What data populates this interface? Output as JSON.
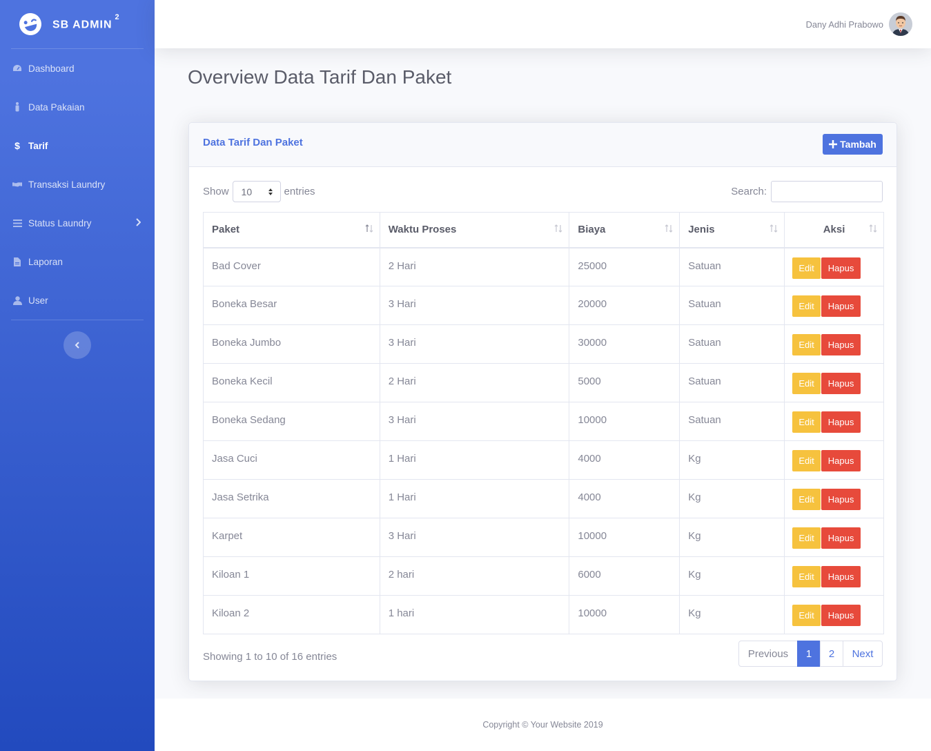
{
  "sidebar": {
    "brand": "SB ADMIN",
    "brand_sup": "2",
    "items": [
      {
        "label": "Dashboard",
        "icon": "tachometer-icon"
      },
      {
        "label": "Data Pakaian",
        "icon": "user-male-icon"
      },
      {
        "label": "Tarif",
        "icon": "dollar-icon",
        "active": true
      },
      {
        "label": "Transaksi Laundry",
        "icon": "handshake-icon"
      },
      {
        "label": "Status Laundry",
        "icon": "bars-icon",
        "has_chevron": true
      },
      {
        "label": "Laporan",
        "icon": "file-icon"
      },
      {
        "label": "User",
        "icon": "user-icon"
      }
    ]
  },
  "topbar": {
    "user_name": "Dany Adhi Prabowo"
  },
  "page": {
    "title": "Overview Data Tarif Dan Paket"
  },
  "card": {
    "title": "Data Tarif Dan Paket",
    "add_button": "Tambah",
    "show_label": "Show",
    "entries_label": "entries",
    "entries_value": "10",
    "search_label": "Search:"
  },
  "table": {
    "headers": [
      "Paket",
      "Waktu Proses",
      "Biaya",
      "Jenis",
      "Aksi"
    ],
    "edit_label": "Edit",
    "delete_label": "Hapus",
    "rows": [
      [
        "Bad Cover",
        "2 Hari",
        "25000",
        "Satuan"
      ],
      [
        "Boneka Besar",
        "3 Hari",
        "20000",
        "Satuan"
      ],
      [
        "Boneka Jumbo",
        "3 Hari",
        "30000",
        "Satuan"
      ],
      [
        "Boneka Kecil",
        "2 Hari",
        "5000",
        "Satuan"
      ],
      [
        "Boneka Sedang",
        "3 Hari",
        "10000",
        "Satuan"
      ],
      [
        "Jasa Cuci",
        "1 Hari",
        "4000",
        "Kg"
      ],
      [
        "Jasa Setrika",
        "1 Hari",
        "4000",
        "Kg"
      ],
      [
        "Karpet",
        "3 Hari",
        "10000",
        "Kg"
      ],
      [
        "Kiloan 1",
        "2 hari",
        "6000",
        "Kg"
      ],
      [
        "Kiloan 2",
        "1 hari",
        "10000",
        "Kg"
      ]
    ]
  },
  "footer_info": "Showing 1 to 10 of 16 entries",
  "pagination": {
    "previous": "Previous",
    "pages": [
      "1",
      "2"
    ],
    "active_page": "1",
    "next": "Next"
  },
  "copyright": "Copyright © Your Website 2019",
  "colors": {
    "primary": "#4e73df",
    "warning": "#f6c23e",
    "danger": "#e74a3b"
  }
}
